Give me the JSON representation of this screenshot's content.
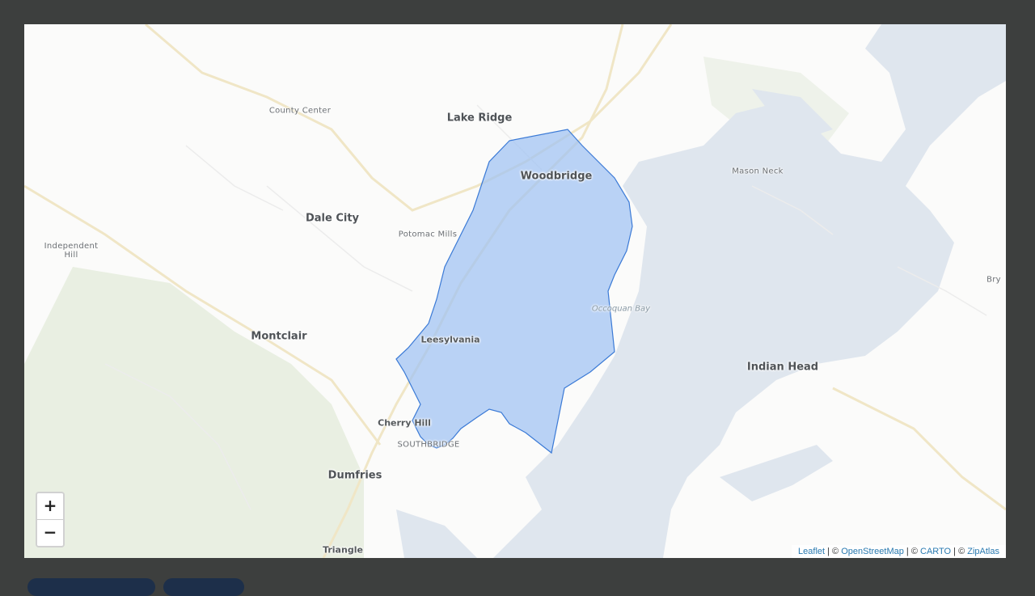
{
  "map": {
    "polygon_fill": "#9fc2f2",
    "polygon_stroke": "#3b7ad6",
    "water_color": "#dfe6ee",
    "land_color": "#fbfbfa",
    "park_color": "#e7eedf"
  },
  "places": [
    {
      "name": "Lake Ridge",
      "size": "lg"
    },
    {
      "name": "County Center",
      "size": "sm"
    },
    {
      "name": "Woodbridge",
      "size": "lg"
    },
    {
      "name": "Mason Neck",
      "size": "sm"
    },
    {
      "name": "Dale City",
      "size": "lg"
    },
    {
      "name": "Potomac Mills",
      "size": "sm"
    },
    {
      "name": "Independent\nHill",
      "size": "sm"
    },
    {
      "name": "Occoquan Bay",
      "size": "water"
    },
    {
      "name": "Bry",
      "size": "sm"
    },
    {
      "name": "Montclair",
      "size": "lg"
    },
    {
      "name": "Leesylvania",
      "size": "md"
    },
    {
      "name": "Indian Head",
      "size": "lg"
    },
    {
      "name": "Cherry Hill",
      "size": "md"
    },
    {
      "name": "SOUTHBRIDGE",
      "size": "sm"
    },
    {
      "name": "Dumfries",
      "size": "lg"
    },
    {
      "name": "Triangle",
      "size": "md"
    }
  ],
  "zoom": {
    "in_label": "+",
    "out_label": "−"
  },
  "attribution": {
    "leaflet": "Leaflet",
    "sep1": " | © ",
    "osm": "OpenStreetMap",
    "sep2": " | © ",
    "carto": "CARTO",
    "sep3": " | © ",
    "zipatlas": "ZipAtlas"
  }
}
